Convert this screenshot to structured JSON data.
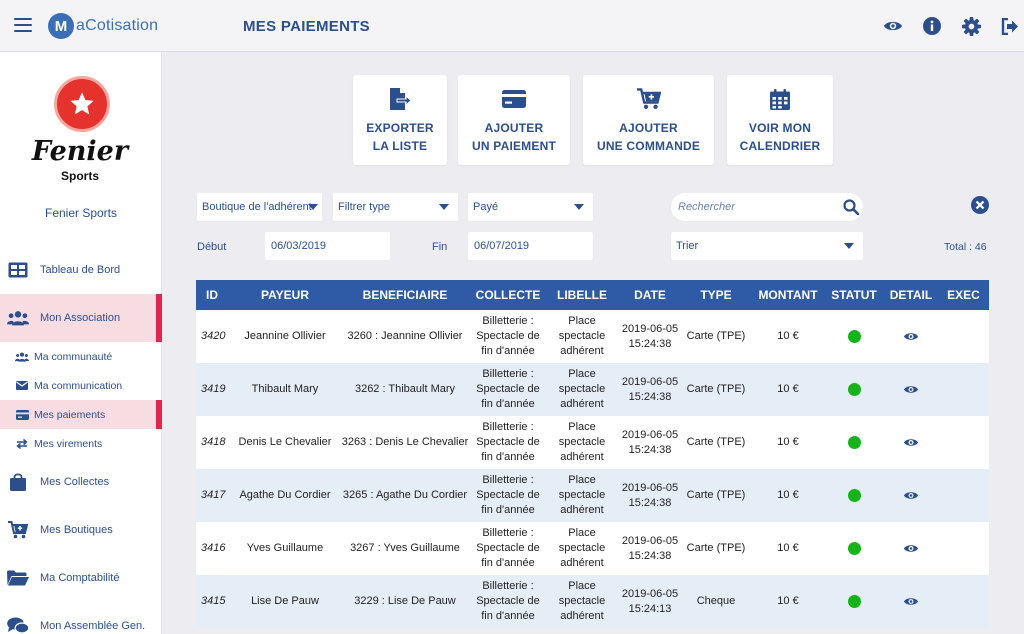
{
  "app": {
    "logo_letter": "M",
    "logo_text": "aCotisation",
    "page_title": "MES PAIEMENTS"
  },
  "header_icons": [
    "eye-icon",
    "info-icon",
    "gear-icon",
    "logout-icon"
  ],
  "club": {
    "name_big": "Fenier",
    "name_small": "Sports",
    "label": "Fenier Sports"
  },
  "nav": {
    "tableau": "Tableau de Bord",
    "association": "Mon Association",
    "communaute": "Ma communauté",
    "communication": "Ma communication",
    "paiements": "Mes paiements",
    "virements": "Mes virements",
    "collectes": "Mes Collectes",
    "boutiques": "Mes Boutiques",
    "comptabilite": "Ma Comptabilité",
    "assemblee": "Mon Assemblée Gen."
  },
  "actions": {
    "export": {
      "l1": "EXPORTER",
      "l2": "LA LISTE"
    },
    "add_payment": {
      "l1": "AJOUTER",
      "l2": "UN PAIEMENT"
    },
    "add_order": {
      "l1": "AJOUTER",
      "l2": "UNE COMMANDE"
    },
    "calendar": {
      "l1": "VOIR MON",
      "l2": "CALENDRIER"
    }
  },
  "filters": {
    "boutique": "Boutique de l'adhérent",
    "type": "Filtrer type",
    "status": "Payé",
    "search_placeholder": "Rechercher",
    "start_label": "Début",
    "start_value": "06/03/2019",
    "end_label": "Fin",
    "end_value": "06/07/2019",
    "sort": "Trier",
    "total": "Total : 46"
  },
  "table": {
    "columns": {
      "id": "ID",
      "payeur": "PAYEUR",
      "benef": "BENEFICIAIRE",
      "collecte": "COLLECTE",
      "libelle": "LIBELLE",
      "date": "DATE",
      "type": "TYPE",
      "montant": "MONTANT",
      "statut": "STATUT",
      "detail": "DETAIL",
      "exec": "EXEC"
    },
    "rows": [
      {
        "id": "3420",
        "payeur": "Jeannine Ollivier",
        "benef": "3260 : Jeannine Ollivier",
        "collecte": "Billetterie : Spectacle de fin d'année",
        "libelle": "Place spectacle adhérent",
        "date": "2019-06-05 15:24:38",
        "type": "Carte (TPE)",
        "montant": "10 €"
      },
      {
        "id": "3419",
        "payeur": "Thibault Mary",
        "benef": "3262 : Thibault Mary",
        "collecte": "Billetterie : Spectacle de fin d'année",
        "libelle": "Place spectacle adhérent",
        "date": "2019-06-05 15:24:38",
        "type": "Carte (TPE)",
        "montant": "10 €"
      },
      {
        "id": "3418",
        "payeur": "Denis Le Chevalier",
        "benef": "3263 : Denis Le Chevalier",
        "collecte": "Billetterie : Spectacle de fin d'année",
        "libelle": "Place spectacle adhérent",
        "date": "2019-06-05 15:24:38",
        "type": "Carte (TPE)",
        "montant": "10 €"
      },
      {
        "id": "3417",
        "payeur": "Agathe Du Cordier",
        "benef": "3265 : Agathe Du Cordier",
        "collecte": "Billetterie : Spectacle de fin d'année",
        "libelle": "Place spectacle adhérent",
        "date": "2019-06-05 15:24:38",
        "type": "Carte (TPE)",
        "montant": "10 €"
      },
      {
        "id": "3416",
        "payeur": "Yves Guillaume",
        "benef": "3267 : Yves Guillaume",
        "collecte": "Billetterie : Spectacle de fin d'année",
        "libelle": "Place spectacle adhérent",
        "date": "2019-06-05 15:24:38",
        "type": "Carte (TPE)",
        "montant": "10 €"
      },
      {
        "id": "3415",
        "payeur": "Lise De Pauw",
        "benef": "3229 : Lise De Pauw",
        "collecte": "Billetterie : Spectacle de fin d'année",
        "libelle": "Place spectacle adhérent",
        "date": "2019-06-05 15:24:13",
        "type": "Cheque",
        "montant": "10 €"
      }
    ]
  },
  "colors": {
    "primary": "#2c4f8c",
    "table_header": "#2f5aa6",
    "active_accent": "#e2264d",
    "status_ok": "#17b31a",
    "row_alt": "#e5edf7"
  }
}
